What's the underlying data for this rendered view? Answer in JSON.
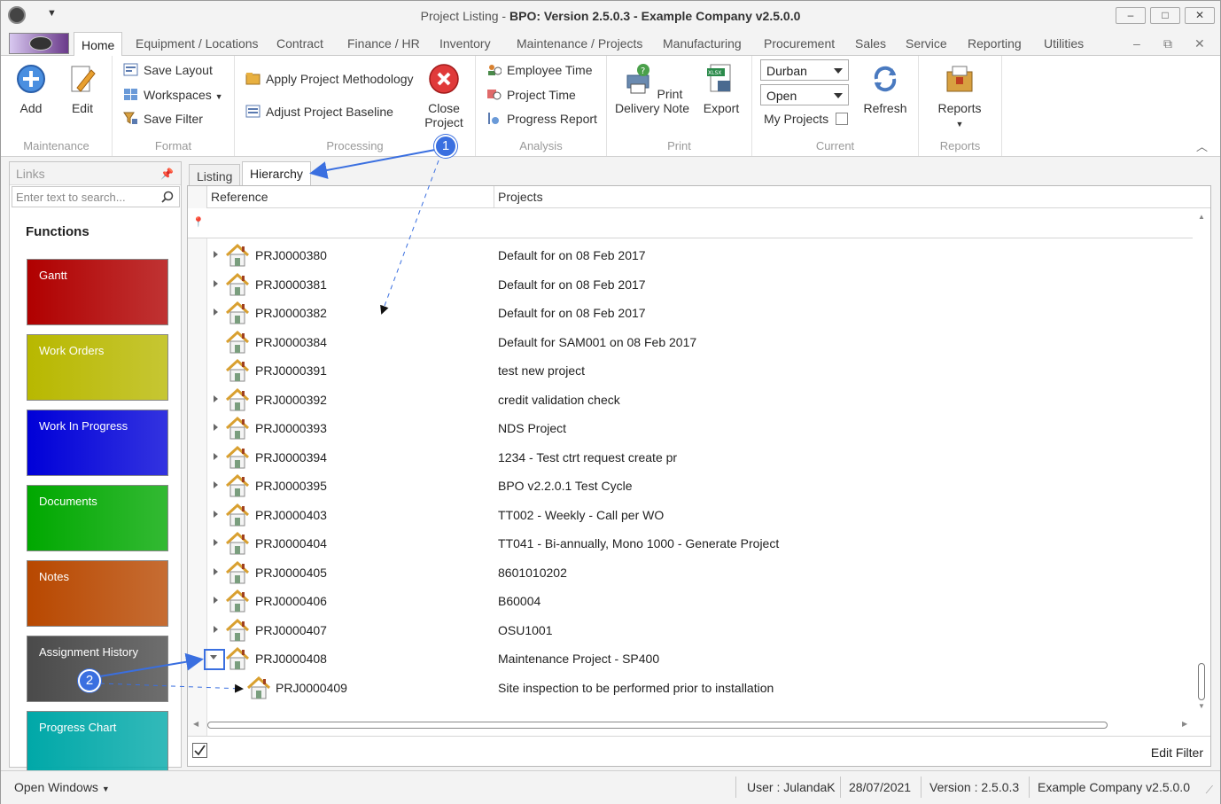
{
  "window": {
    "title_prefix": "Project Listing",
    "title_sep": " - ",
    "title_main": "BPO: Version 2.5.0.3 - Example Company v2.5.0.0",
    "minimize": "–",
    "maximize": "□",
    "close": "✕"
  },
  "menu": {
    "tabs": [
      "Home",
      "Equipment / Locations",
      "Contract",
      "Finance / HR",
      "Inventory",
      "Maintenance / Projects",
      "Manufacturing",
      "Procurement",
      "Sales",
      "Service",
      "Reporting",
      "Utilities"
    ],
    "mdi_min": "–",
    "mdi_restore": "⧉",
    "mdi_close": "✕"
  },
  "ribbon": {
    "maintenance": {
      "label": "Maintenance",
      "add": "Add",
      "edit": "Edit"
    },
    "format": {
      "label": "Format",
      "save_layout": "Save Layout",
      "workspaces": "Workspaces",
      "save_filter": "Save Filter"
    },
    "processing": {
      "label": "Processing",
      "apply_methodology": "Apply Project Methodology",
      "adjust_baseline": "Adjust Project Baseline",
      "close_project_1": "Close",
      "close_project_2": "Project"
    },
    "analysis": {
      "label": "Analysis",
      "employee_time": "Employee Time",
      "project_time": "Project Time",
      "progress_report": "Progress Report"
    },
    "print": {
      "label": "Print",
      "print_1": "Print",
      "print_2": "Delivery Note",
      "export": "Export",
      "xlsx": "XLSX"
    },
    "current": {
      "label": "Current",
      "site": "Durban",
      "status": "Open",
      "my_projects": "My Projects",
      "refresh": "Refresh"
    },
    "reports": {
      "label": "Reports",
      "reports": "Reports"
    }
  },
  "links": {
    "header": "Links",
    "search_placeholder": "Enter text to search...",
    "functions_title": "Functions",
    "buttons": [
      {
        "label": "Gantt",
        "color": "#b00000"
      },
      {
        "label": "Work Orders",
        "color": "#b8b800"
      },
      {
        "label": "Work In Progress",
        "color": "#0000d8"
      },
      {
        "label": "Documents",
        "color": "#00a800"
      },
      {
        "label": "Notes",
        "color": "#b84800"
      },
      {
        "label": "Assignment History",
        "color": "#4a4a4a"
      },
      {
        "label": "Progress Chart",
        "color": "#00a8a8"
      }
    ]
  },
  "content": {
    "tabs": [
      "Listing",
      "Hierarchy"
    ],
    "columns": [
      "Reference",
      "Projects"
    ],
    "rows": [
      {
        "ref": "PRJ0000380",
        "proj": "Default for  on 08 Feb 2017",
        "expander": "collapsed"
      },
      {
        "ref": "PRJ0000381",
        "proj": "Default for  on 08 Feb 2017",
        "expander": "collapsed"
      },
      {
        "ref": "PRJ0000382",
        "proj": "Default for  on 08 Feb 2017",
        "expander": "collapsed"
      },
      {
        "ref": "PRJ0000384",
        "proj": "Default for SAM001 on 08 Feb 2017",
        "expander": "none"
      },
      {
        "ref": "PRJ0000391",
        "proj": "test new project",
        "expander": "none"
      },
      {
        "ref": "PRJ0000392",
        "proj": "credit validation check",
        "expander": "collapsed"
      },
      {
        "ref": "PRJ0000393",
        "proj": "NDS Project",
        "expander": "collapsed"
      },
      {
        "ref": "PRJ0000394",
        "proj": "1234 - Test ctrt request create pr",
        "expander": "collapsed"
      },
      {
        "ref": "PRJ0000395",
        "proj": "BPO v2.2.0.1 Test Cycle",
        "expander": "collapsed"
      },
      {
        "ref": "PRJ0000403",
        "proj": "TT002 - Weekly - Call per WO",
        "expander": "collapsed"
      },
      {
        "ref": "PRJ0000404",
        "proj": "TT041 - Bi-annually, Mono 1000 - Generate Project",
        "expander": "collapsed"
      },
      {
        "ref": "PRJ0000405",
        "proj": "8601010202",
        "expander": "collapsed"
      },
      {
        "ref": "PRJ0000406",
        "proj": "B60004",
        "expander": "collapsed"
      },
      {
        "ref": "PRJ0000407",
        "proj": "OSU1001",
        "expander": "collapsed"
      },
      {
        "ref": "PRJ0000408",
        "proj": "Maintenance Project - SP400",
        "expander": "expanded"
      },
      {
        "ref": "PRJ0000409",
        "proj": "Site inspection to be performed prior to installation",
        "expander": "child"
      }
    ],
    "edit_filter": "Edit Filter"
  },
  "status": {
    "open_windows": "Open Windows",
    "user": "User : JulandaK",
    "date": "28/07/2021",
    "version": "Version : 2.5.0.3",
    "company": "Example Company v2.5.0.0"
  },
  "callouts": [
    "1",
    "2"
  ],
  "colors": {
    "accent": "#3a6fe0",
    "house_roof": "#d9a030",
    "house_body": "#7a9e7e"
  }
}
